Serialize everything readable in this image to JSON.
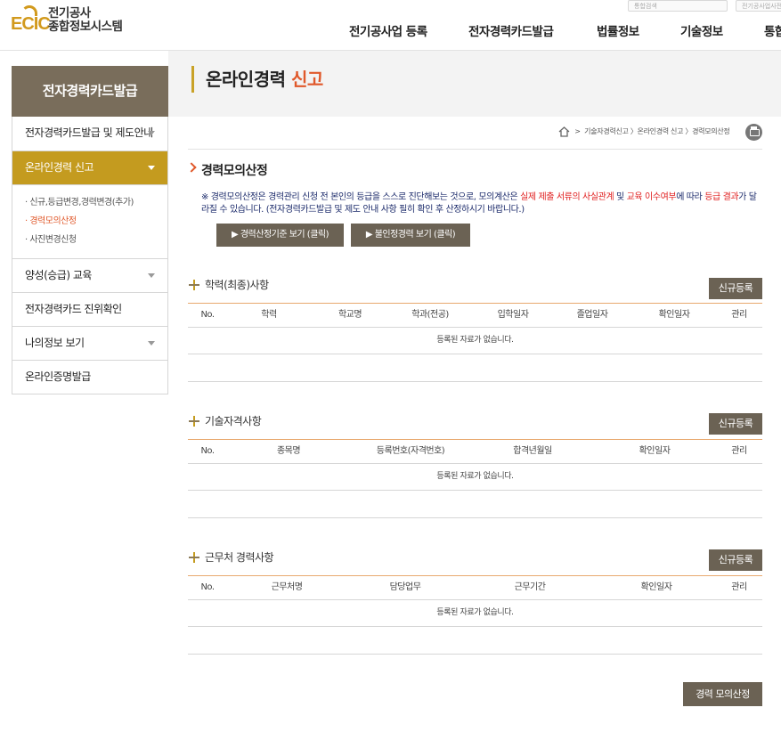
{
  "header": {
    "logo_mark": "ECIC",
    "logo_line1": "전기공사",
    "logo_line2": "종합정보시스템",
    "search_placeholder": "통합검색",
    "search2_placeholder": "전기공사업사전",
    "nav": [
      "전기공사업 등록",
      "전자경력카드발급",
      "법률정보",
      "기술정보",
      "통합"
    ]
  },
  "page_title": {
    "main": "온라인경력",
    "accent": "신고"
  },
  "sidebar": {
    "heading": "전자경력카드발급",
    "items": [
      {
        "label": "전자경력카드발급 및 제도안내"
      },
      {
        "label": "온라인경력 신고"
      },
      {
        "label": "양성(승급) 교육"
      },
      {
        "label": "전자경력카드 진위확인"
      },
      {
        "label": "나의정보 보기"
      },
      {
        "label": "온라인증명발급"
      }
    ],
    "sub_items": [
      {
        "label": "· 신규,등급변경,경력변경(추가)"
      },
      {
        "label": "· 경력모의산정"
      },
      {
        "label": "· 사진변경신청"
      }
    ]
  },
  "breadcrumb": {
    "sep": ">",
    "path": "기술자경력신고 〉온라인경력 신고 〉경력모의산정"
  },
  "section": {
    "title": "경력모의산정",
    "notice_1": "※ 경력모의산정은 경력관리 신청 전 본인의 등급을 스스로 진단해보는 것으로, 모의계산은 ",
    "notice_red1": "실제 제출 서류의 사실관계",
    "notice_2": " 및 ",
    "notice_red2": "교육 이수여부",
    "notice_3": "에 따라 ",
    "notice_red3": "등급 결과",
    "notice_4": "가 달라질 수 있습니다. (전자경력카드발급 및 제도 안내 사항 필히 확인 후 산정하시기 바랍니다.)",
    "btn_criteria": "▶ 경력산정기준 보기 (클릭)",
    "btn_unrecognized": "▶ 불인정경력 보기 (클릭)"
  },
  "education": {
    "title": "학력(최종)사항",
    "new_label": "신규등록",
    "columns": [
      "No.",
      "학력",
      "학교명",
      "학과(전공)",
      "입학일자",
      "졸업일자",
      "확인일자",
      "관리"
    ],
    "empty": "등록된 자료가 없습니다."
  },
  "license": {
    "title": "기술자격사항",
    "new_label": "신규등록",
    "columns": [
      "No.",
      "종목명",
      "등록번호(자격번호)",
      "합격년월일",
      "확인일자",
      "관리"
    ],
    "empty": "등록된 자료가 없습니다."
  },
  "career": {
    "title": "근무처 경력사항",
    "new_label": "신규등록",
    "columns": [
      "No.",
      "근무처명",
      "담당업무",
      "근무기간",
      "확인일자",
      "관리"
    ],
    "empty": "등록된 자료가 없습니다."
  },
  "footer": {
    "calc_label": "경력 모의산정"
  },
  "colors": {
    "accent_orange": "#e0582a",
    "gold": "#c49b1f",
    "brown_button": "#6b6254",
    "sidebar_head": "#796d5b",
    "notice_navy": "#1c2b6b"
  }
}
